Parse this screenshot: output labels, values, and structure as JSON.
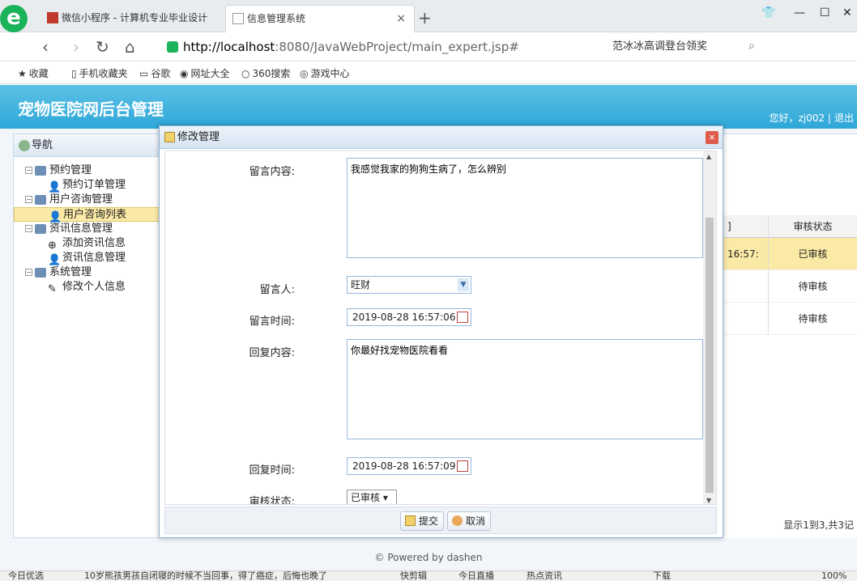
{
  "browser": {
    "logo": "e",
    "tabs": [
      {
        "title": "微信小程序 - 计算机专业毕业设计",
        "active": false
      },
      {
        "title": "信息管理系统",
        "active": true
      }
    ],
    "tab_close": "×",
    "new_tab": "+",
    "window_controls": {
      "skin": "👕",
      "minimize": "—",
      "maximize": "☐",
      "close": "✕"
    },
    "nav": {
      "back": "‹",
      "forward": "›",
      "reload": "↻",
      "home": "⌂"
    },
    "url": {
      "host": "http://localhost",
      "rest": ":8080/JavaWebProject/main_expert.jsp#"
    },
    "search_text": "范冰冰高调登台领奖",
    "bookmarks": [
      {
        "icon": "★",
        "label": "收藏"
      },
      {
        "icon": "▯",
        "label": "手机收藏夹"
      },
      {
        "icon": "▭",
        "label": "谷歌"
      },
      {
        "icon": "◉",
        "label": "网址大全"
      },
      {
        "icon": "○",
        "label": "360搜索"
      },
      {
        "icon": "◎",
        "label": "游戏中心"
      }
    ]
  },
  "app": {
    "title": "宠物医院网后台管理",
    "user_greeting": "您好，zj002 |",
    "logout": "退出",
    "sidebar": {
      "header": "导航",
      "items": [
        {
          "level": 1,
          "label": "预约管理"
        },
        {
          "level": 2,
          "label": "预约订单管理"
        },
        {
          "level": 1,
          "label": "用户咨询管理"
        },
        {
          "level": 2,
          "label": "用户咨询列表",
          "selected": true
        },
        {
          "level": 1,
          "label": "资讯信息管理"
        },
        {
          "level": 2,
          "label": "添加资讯信息"
        },
        {
          "level": 2,
          "label": "资讯信息管理"
        },
        {
          "level": 1,
          "label": "系统管理"
        },
        {
          "level": 2,
          "label": "修改个人信息"
        }
      ]
    },
    "grid": {
      "header_status": "审核状态",
      "header_partial": "]",
      "rows": [
        {
          "time_partial": "16:57:",
          "status": "已审核"
        },
        {
          "time_partial": "",
          "status": "待审核"
        },
        {
          "time_partial": "",
          "status": "待审核"
        }
      ],
      "pager": "显示1到3,共3记"
    },
    "footer": "© Powered by dashen"
  },
  "modal": {
    "title": "修改管理",
    "close": "×",
    "fields": {
      "message_label": "留言内容:",
      "message_value": "我感觉我家的狗狗生病了，怎么辨别",
      "author_label": "留言人:",
      "author_value": "旺财",
      "message_time_label": "留言时间:",
      "message_time_value": "2019-08-28 16:57:06",
      "reply_label": "回复内容:",
      "reply_value": "你最好找宠物医院看看",
      "reply_time_label": "回复时间:",
      "reply_time_value": "2019-08-28 16:57:09",
      "status_label": "审核状态:",
      "status_value": "已审核"
    },
    "submit": "提交",
    "cancel": "取消"
  },
  "statusbar": {
    "items": [
      "今日优选",
      "10岁熊孩男孩自闭寝的时候不当回事，得了癌症，后悔也晚了",
      "快剪辑",
      "今日直播",
      "热点资讯",
      "下载",
      "100%"
    ]
  }
}
